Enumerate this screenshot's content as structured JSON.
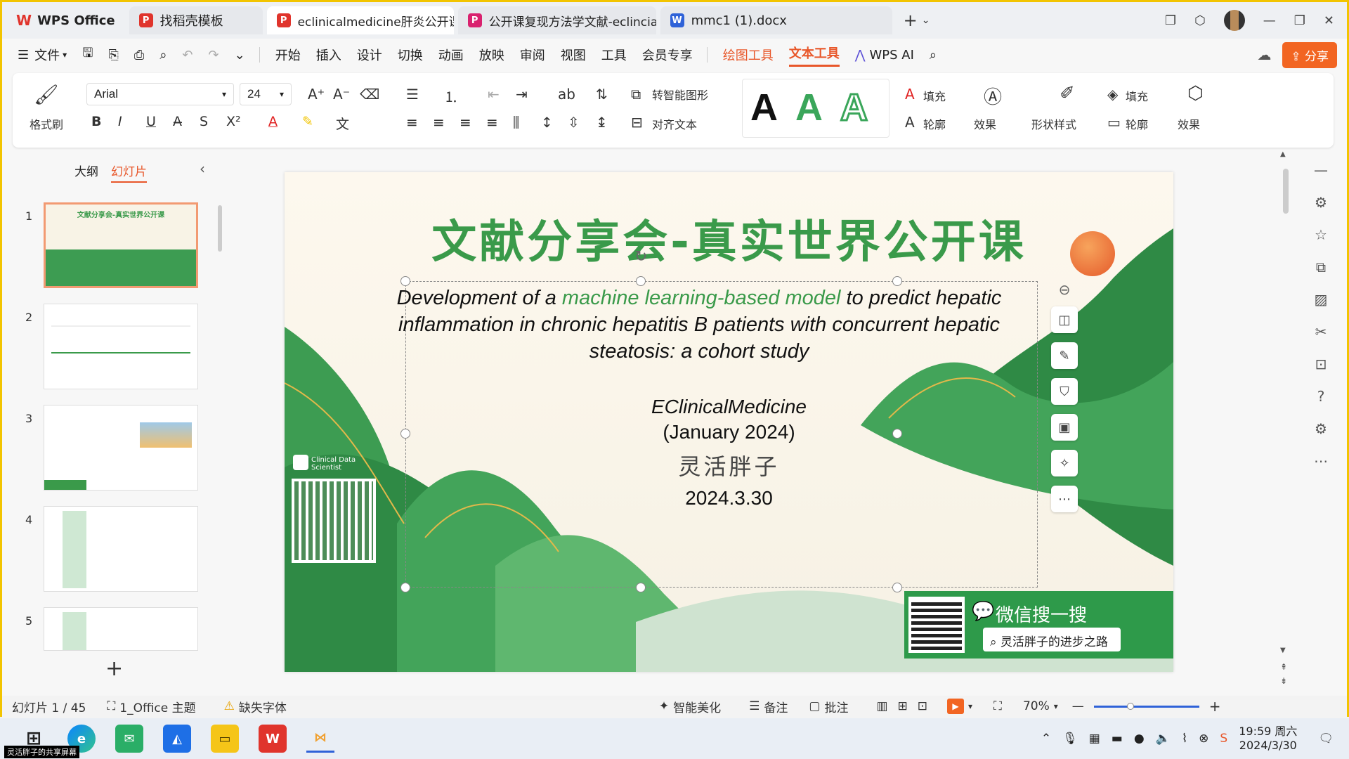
{
  "titlebar": {
    "home_tab": "WPS Office",
    "tabs": [
      {
        "label": "找稻壳模板",
        "color": "#e0342c",
        "ico": "P"
      },
      {
        "label": "eclinicalmedicine肝炎公开课.pptx",
        "color": "#e0342c",
        "ico": "P"
      },
      {
        "label": "公开课复现方法学文献-eclincialmedi",
        "color": "#d9226f",
        "ico": "P"
      },
      {
        "label": "mmc1 (1).docx",
        "color": "#2f62d8",
        "ico": "W"
      }
    ],
    "new_tab_icon": "plus-icon"
  },
  "menubar": {
    "file": "文件",
    "items": [
      "开始",
      "插入",
      "设计",
      "切换",
      "动画",
      "放映",
      "审阅",
      "视图",
      "工具",
      "会员专享"
    ],
    "drawing_tools": "绘图工具",
    "text_tools": "文本工具",
    "wps_ai": "WPS AI",
    "share": "分享"
  },
  "ribbon": {
    "format_painter": "格式刷",
    "font_name": "Arial",
    "font_size": "24",
    "smart_shape": "转智能图形",
    "align_text": "对齐文本",
    "fill": "填充",
    "outline": "轮廓",
    "effect": "效果",
    "shape_style": "形状样式",
    "shape_fill": "填充",
    "shape_outline": "轮廓",
    "shape_effect": "效果",
    "text_style_colors": [
      "#111111",
      "#3aa65a",
      "#3aa65a"
    ]
  },
  "leftpane": {
    "tab_outline": "大纲",
    "tab_slides": "幻灯片",
    "slide_numbers": [
      "1",
      "2",
      "3",
      "4",
      "5"
    ]
  },
  "slide": {
    "title": "文献分享会-真实世界公开课",
    "subtitle_part1": "Development of a ",
    "subtitle_highlight": "machine learning-based model",
    "subtitle_part2": " to predict hepatic inflammation in chronic hepatitis B patients with concurrent hepatic steatosis: a cohort study",
    "journal": "EClinicalMedicine",
    "journal_date": "(January 2024)",
    "author": "灵活胖子",
    "date": "2024.3.30",
    "qr_label": "Clinical Data Scientist",
    "wechat_title": "微信搜一搜",
    "wechat_search": "灵活胖子的进步之路"
  },
  "statusbar": {
    "slide_counter": "幻灯片 1 / 45",
    "theme": "1_Office 主题",
    "missing_font": "缺失字体",
    "beautify": "智能美化",
    "notes": "备注",
    "comment": "批注",
    "zoom": "70%",
    "zoom_level": 0.35
  },
  "taskbar": {
    "share_label": "灵活胖子的共享屏幕",
    "time": "19:59 周六",
    "date": "2024/3/30"
  }
}
